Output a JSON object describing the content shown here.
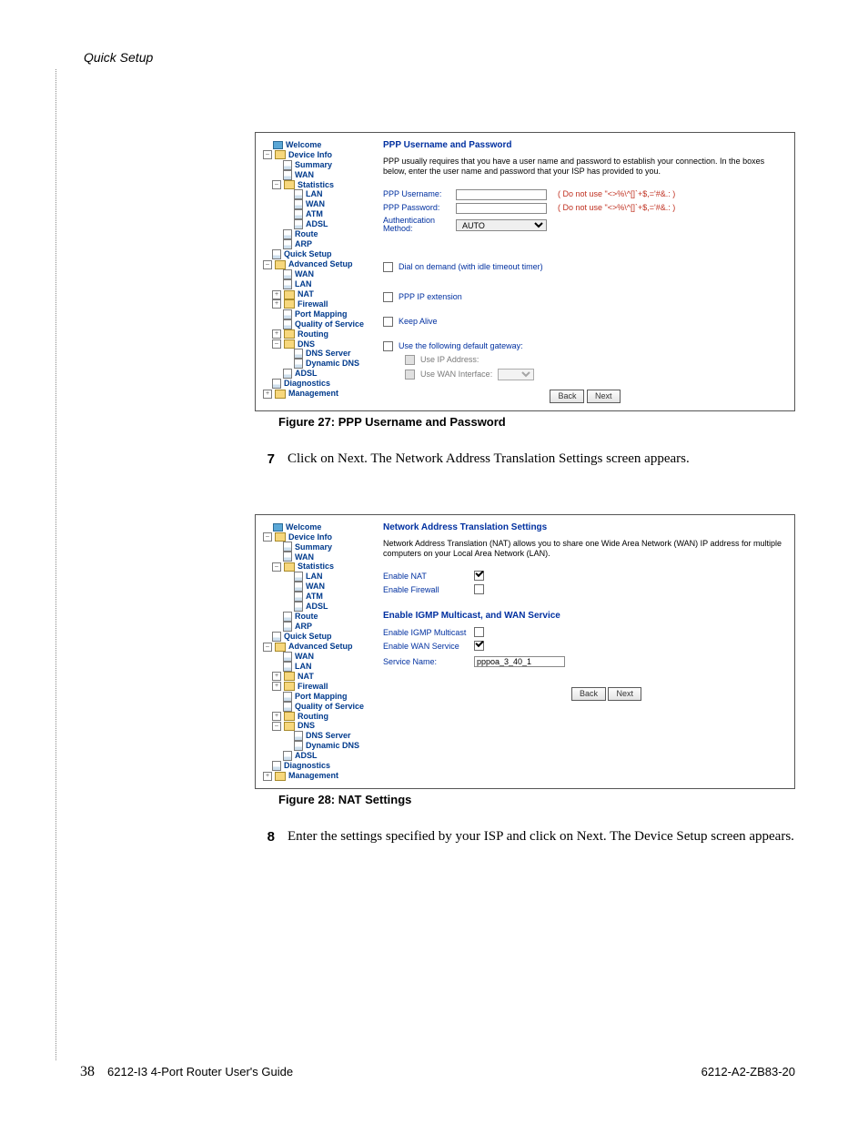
{
  "header": {
    "title": "Quick Setup"
  },
  "footer": {
    "page_number": "38",
    "doc_title": "6212-I3 4-Port Router User's Guide",
    "doc_code": "6212-A2-ZB83-20"
  },
  "figure27": {
    "caption": "Figure 27: PPP Username and Password",
    "nav": {
      "welcome": "Welcome",
      "device_info": "Device Info",
      "summary": "Summary",
      "wan": "WAN",
      "statistics": "Statistics",
      "stat_lan": "LAN",
      "stat_wan": "WAN",
      "stat_atm": "ATM",
      "stat_adsl": "ADSL",
      "route": "Route",
      "arp": "ARP",
      "quick_setup": "Quick Setup",
      "advanced_setup": "Advanced Setup",
      "adv_wan": "WAN",
      "adv_lan": "LAN",
      "adv_nat": "NAT",
      "adv_firewall": "Firewall",
      "adv_port_mapping": "Port Mapping",
      "adv_qos": "Quality of Service",
      "adv_routing": "Routing",
      "adv_dns": "DNS",
      "adv_dns_server": "DNS Server",
      "adv_dyn_dns": "Dynamic DNS",
      "adv_adsl": "ADSL",
      "diagnostics": "Diagnostics",
      "management": "Management"
    },
    "panel": {
      "title": "PPP Username and Password",
      "desc": "PPP usually requires that you have a user name and password to establish your connection. In the boxes below, enter the user name and password that your ISP has provided to you.",
      "username_label": "PPP Username:",
      "username_value": "",
      "username_hint": "( Do not use \"<>%\\^[]`+$,='#&.: )",
      "password_label": "PPP Password:",
      "password_value": "",
      "password_hint": "( Do not use \"<>%\\^[]`+$,='#&.: )",
      "auth_label": "Authentication Method:",
      "auth_value": "AUTO",
      "dial_on_demand": "Dial on demand (with idle timeout timer)",
      "ppp_ip_ext": "PPP IP extension",
      "keep_alive": "Keep Alive",
      "use_default_gw": "Use the following default gateway:",
      "use_ip_addr": "Use IP Address:",
      "use_wan_iface": "Use WAN Interface:",
      "back": "Back",
      "next": "Next"
    }
  },
  "step7": {
    "num": "7",
    "text": "Click on Next. The Network Address Translation Settings screen appears."
  },
  "figure28": {
    "caption": "Figure 28: NAT Settings",
    "nav": {
      "welcome": "Welcome",
      "device_info": "Device Info",
      "summary": "Summary",
      "wan": "WAN",
      "statistics": "Statistics",
      "stat_lan": "LAN",
      "stat_wan": "WAN",
      "stat_atm": "ATM",
      "stat_adsl": "ADSL",
      "route": "Route",
      "arp": "ARP",
      "quick_setup": "Quick Setup",
      "advanced_setup": "Advanced Setup",
      "adv_wan": "WAN",
      "adv_lan": "LAN",
      "adv_nat": "NAT",
      "adv_firewall": "Firewall",
      "adv_port_mapping": "Port Mapping",
      "adv_qos": "Quality of Service",
      "adv_routing": "Routing",
      "adv_dns": "DNS",
      "adv_dns_server": "DNS Server",
      "adv_dyn_dns": "Dynamic DNS",
      "adv_adsl": "ADSL",
      "diagnostics": "Diagnostics",
      "management": "Management"
    },
    "panel": {
      "title": "Network Address Translation Settings",
      "desc": "Network Address Translation (NAT) allows you to share one Wide Area Network (WAN) IP address for multiple computers on your Local Area Network (LAN).",
      "enable_nat": "Enable NAT",
      "enable_firewall": "Enable Firewall",
      "igmp_section": "Enable IGMP Multicast, and WAN Service",
      "enable_igmp": "Enable IGMP Multicast",
      "enable_wan_service": "Enable WAN Service",
      "service_name_label": "Service Name:",
      "service_name_value": "pppoa_3_40_1",
      "back": "Back",
      "next": "Next"
    }
  },
  "step8": {
    "num": "8",
    "text": "Enter the settings specified by your ISP and click on Next. The Device Setup screen appears."
  }
}
